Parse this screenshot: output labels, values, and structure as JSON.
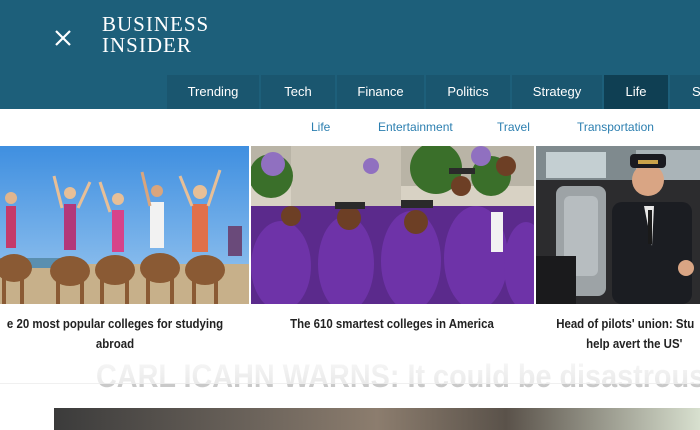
{
  "header": {
    "logo_line1": "BUSINESS",
    "logo_line2": "INSIDER",
    "close_icon": "close-icon",
    "background_color": "#1d5f7a"
  },
  "nav": {
    "items": [
      "Trending",
      "Tech",
      "Finance",
      "Politics",
      "Strategy",
      "Life",
      "S"
    ],
    "active": "Life"
  },
  "subnav": {
    "items": [
      "Life",
      "Entertainment",
      "Travel",
      "Transportation"
    ],
    "link_color": "#2c7fb0"
  },
  "cards": [
    {
      "title_line1": "e 20 most popular colleges for studying",
      "title_line2": "abroad"
    },
    {
      "title_line1": "The 610 smartest colleges in America",
      "title_line2": ""
    },
    {
      "title_line1": "Head of pilots' union: Stu",
      "title_line2": "help avert the US'"
    }
  ],
  "headline": "CARL ICAHN WARNS: It could be disastrous"
}
